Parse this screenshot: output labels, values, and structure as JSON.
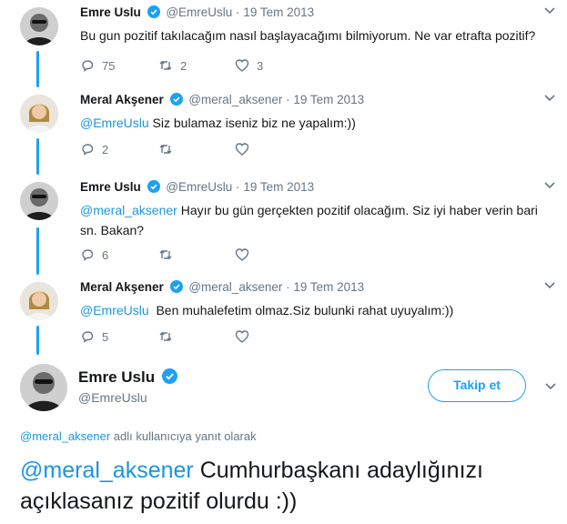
{
  "colors": {
    "accent": "#1da1f2",
    "mention": "#1b95e0",
    "muted": "#657786"
  },
  "tweets": [
    {
      "name": "Emre Uslu",
      "handle": "@EmreUslu",
      "sep": "·",
      "date": "19 Tem 2013",
      "mention": "",
      "text": "Bu gun pozitif takılacağım nasıl başlayacağımı bilmiyorum. Ne var etrafta pozitif?",
      "replies": "75",
      "retweets": "2",
      "likes": "3"
    },
    {
      "name": "Meral Akşener",
      "handle": "@meral_aksener",
      "sep": "·",
      "date": "19 Tem 2013",
      "mention": "@EmreUslu",
      "text": " Siz bulamaz iseniz biz ne yapalım:))",
      "replies": "2",
      "retweets": "",
      "likes": ""
    },
    {
      "name": "Emre Uslu",
      "handle": "@EmreUslu",
      "sep": "·",
      "date": "19 Tem 2013",
      "mention": "@meral_aksener",
      "text": " Hayır bu gün gerçekten pozitif olacağım. Siz iyi haber verin bari sn. Bakan?",
      "replies": "6",
      "retweets": "",
      "likes": ""
    },
    {
      "name": "Meral Akşener",
      "handle": "@meral_aksener",
      "sep": "·",
      "date": "19 Tem 2013",
      "mention": "@EmreUslu",
      "text": "  Ben muhalefetim olmaz.Siz bulunki rahat uyuyalım:))",
      "replies": "5",
      "retweets": "",
      "likes": ""
    }
  ],
  "main": {
    "name": "Emre Uslu",
    "handle": "@EmreUslu",
    "follow_label": "Takip et",
    "reply_mention": "@meral_aksener",
    "reply_suffix": " adlı kullanıcıya yanıt olarak",
    "mention": "@meral_aksener",
    "text": " Cumhurbaşkanı adaylığınızı açıklasanız pozitif olurdu :))"
  }
}
